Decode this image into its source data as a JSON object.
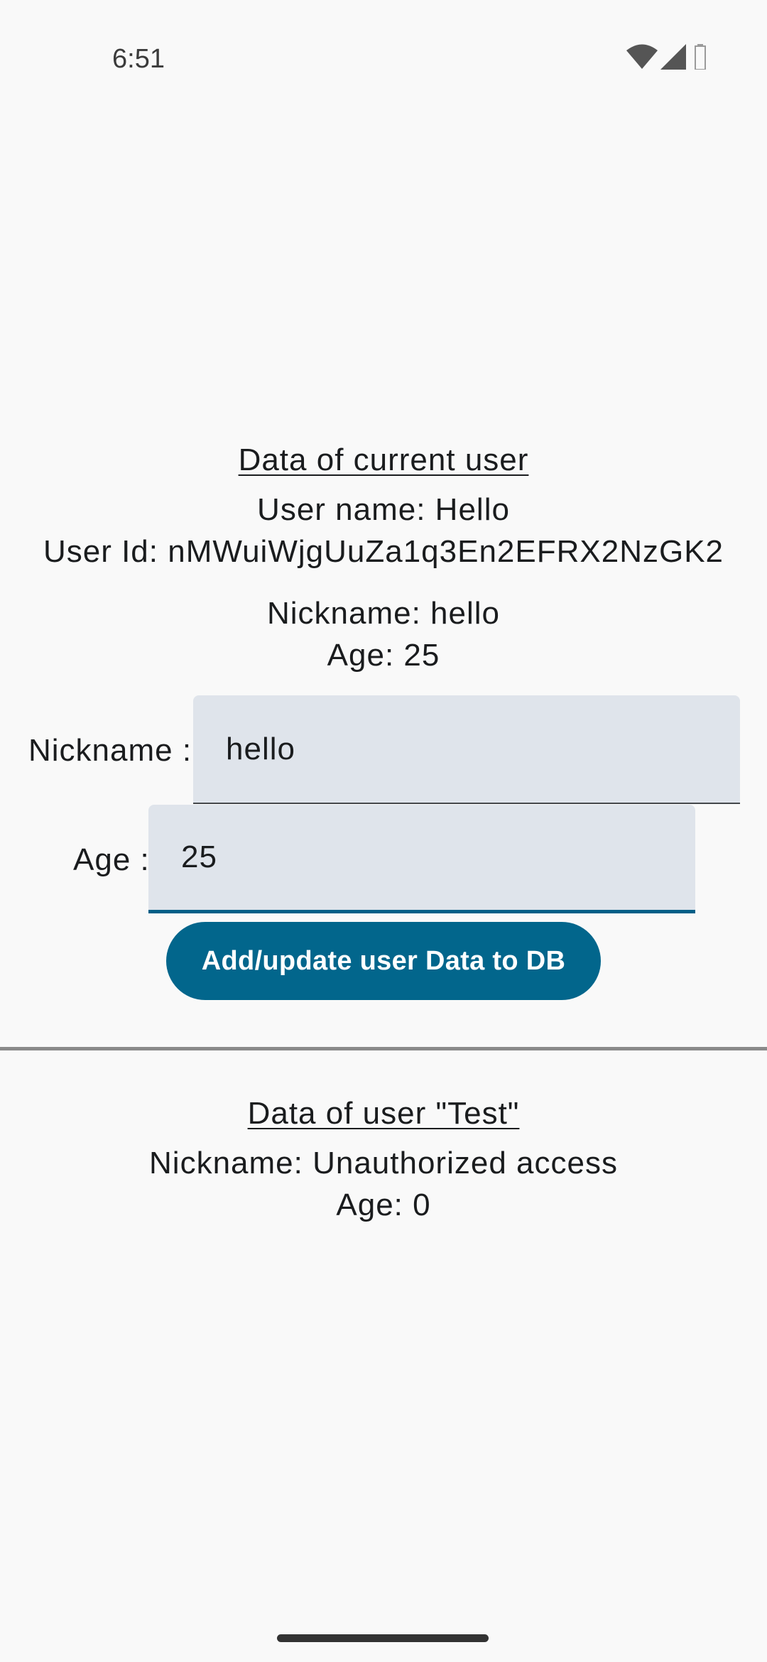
{
  "status_bar": {
    "time": "6:51",
    "icons": [
      "wifi-icon",
      "cell-signal-icon",
      "battery-icon"
    ]
  },
  "current_user": {
    "heading": "Data of current user",
    "user_name": "User name: Hello",
    "user_id": "User Id: nMWuiWjgUuZa1q3En2EFRX2NzGK2",
    "nickname": "Nickname: hello",
    "age": "Age: 25"
  },
  "form": {
    "nickname_label": "Nickname :",
    "nickname_value": "hello",
    "age_label": "Age :",
    "age_value": "25",
    "submit_label": "Add/update user Data to DB"
  },
  "test_user": {
    "heading": "Data of user \"Test\"",
    "nickname": "Nickname: Unauthorized access",
    "age": "Age: 0"
  },
  "colors": {
    "background": "#f9f9f9",
    "field_background": "#dfe4eb",
    "accent": "#02668c",
    "divider": "#8a8a8a"
  }
}
